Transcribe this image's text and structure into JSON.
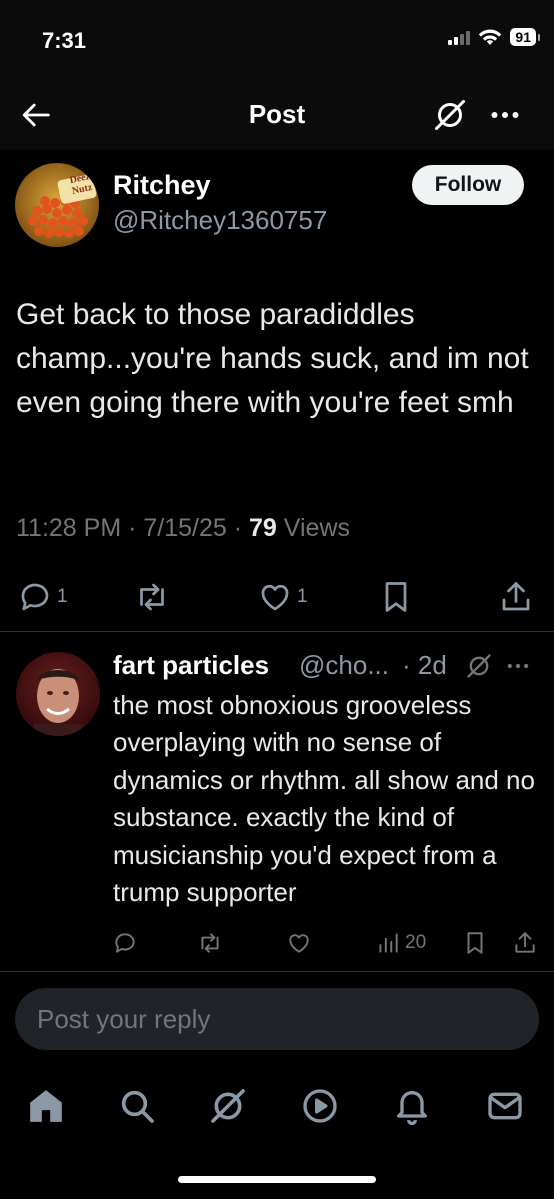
{
  "status_bar": {
    "time": "7:31",
    "battery": "91"
  },
  "header": {
    "title": "Post"
  },
  "post": {
    "author_name": "Ritchey",
    "author_handle": "@Ritchey1360757",
    "follow_label": "Follow",
    "avatar_label_1": "Deez",
    "avatar_label_2": "Nutz",
    "text": "Get back to those paradiddles champ...you're hands suck, and im not even going there with you're feet smh",
    "time": "11:28 PM",
    "date": "7/15/25",
    "views_count": "79",
    "views_label": "Views",
    "reply_count": "1",
    "like_count": "1"
  },
  "reply": {
    "author_name": "fart particles",
    "author_handle": "@cho...",
    "time": "· 2d",
    "text": "the most obnoxious grooveless overplaying with no sense of dynamics or rhythm. all show and no substance. exactly the kind of musicianship you'd expect from a trump supporter",
    "views_count": "20"
  },
  "composer": {
    "placeholder": "Post your reply"
  },
  "tabs": [
    "home",
    "search",
    "grok",
    "video",
    "notifications",
    "messages"
  ],
  "colors": {
    "background": "#000000",
    "text_primary": "#e7e9ea",
    "text_secondary": "#71767b",
    "composer_bg": "#202327",
    "follow_bg": "#eff3f4"
  }
}
